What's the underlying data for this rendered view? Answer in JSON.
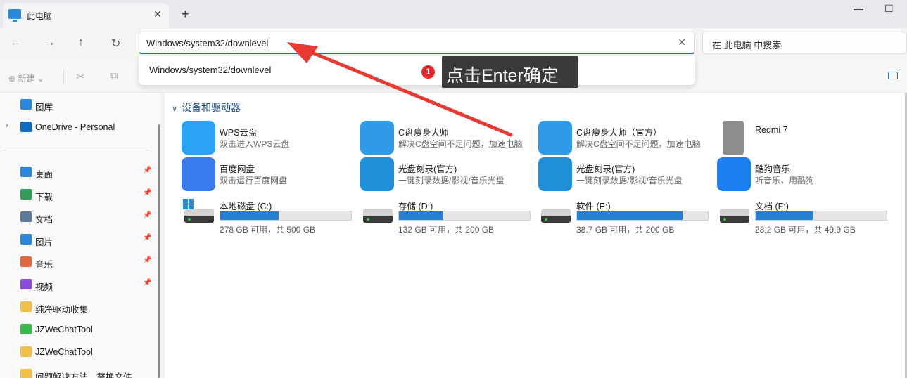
{
  "window": {
    "tab_title": "此电脑",
    "tab_close": "✕",
    "new_tab": "+",
    "min": "—",
    "max": "☐"
  },
  "nav": {
    "back": "←",
    "forward": "→",
    "up": "↑",
    "refresh": "↻"
  },
  "address": {
    "value": "Windows/system32/downlevel",
    "clear": "✕"
  },
  "search": {
    "placeholder": "在 此电脑 中搜索"
  },
  "toolbar": {
    "new_label": "新建 ⌄",
    "cut": "✂",
    "copy": "⧉"
  },
  "suggestion": {
    "text": "Windows/system32/downlevel"
  },
  "annotation": {
    "badge": "1",
    "text": "点击Enter确定",
    "arrow_color": "#e83a33"
  },
  "sidebar": {
    "items": [
      {
        "label": "图库",
        "icon": "gallery-icon",
        "color": "#2b88d8"
      },
      {
        "label": "OneDrive - Personal",
        "icon": "onedrive-icon",
        "color": "#0f6cbd",
        "expand": "›"
      },
      {
        "label": "桌面",
        "icon": "desktop-icon",
        "color": "#2b88d8",
        "pin": "📌"
      },
      {
        "label": "下载",
        "icon": "download-icon",
        "color": "#2e9e58",
        "pin": "📌"
      },
      {
        "label": "文档",
        "icon": "document-icon",
        "color": "#5c7a99",
        "pin": "📌"
      },
      {
        "label": "图片",
        "icon": "picture-icon",
        "color": "#2b88d8",
        "pin": "📌"
      },
      {
        "label": "音乐",
        "icon": "music-icon",
        "color": "#e0673e",
        "pin": "📌"
      },
      {
        "label": "视频",
        "icon": "video-icon",
        "color": "#8a4bd6",
        "pin": "📌"
      },
      {
        "label": "纯净驱动收集",
        "icon": "folder-icon",
        "color": "#f2c04a"
      },
      {
        "label": "JZWeChatTool",
        "icon": "wechat-icon",
        "color": "#35b94a"
      },
      {
        "label": "JZWeChatTool",
        "icon": "folder-icon",
        "color": "#f2c04a"
      },
      {
        "label": "问题解决方法、替换文件",
        "icon": "folder-icon",
        "color": "#f2c04a"
      }
    ]
  },
  "section": {
    "chevron": "∨",
    "title": "设备和驱动器"
  },
  "devices": [
    {
      "name": "WPS云盘",
      "sub": "双击进入WPS云盘",
      "icon": "wps-cloud-icon",
      "color": "#2ba3f5"
    },
    {
      "name": "C盘瘦身大师",
      "sub": "解决C盘空间不足问题，加速电脑",
      "icon": "c-cleaner-icon",
      "color": "#2f9be8"
    },
    {
      "name": "C盘瘦身大师（官方）",
      "sub": "解决C盘空间不足问题，加速电脑",
      "icon": "c-cleaner-icon",
      "color": "#2f9be8"
    },
    {
      "name": "Redmi 7",
      "sub": "",
      "icon": "phone-icon",
      "color": "#8d8d8d"
    },
    {
      "name": "百度网盘",
      "sub": "双击运行百度网盘",
      "icon": "baidu-netdisk-icon",
      "color": "#3a7bf0"
    },
    {
      "name": "光盘刻录(官方)",
      "sub": "一键刻录数据/影视/音乐光盘",
      "icon": "disc-burn-icon",
      "color": "#1f8fd8"
    },
    {
      "name": "光盘刻录(官方)",
      "sub": "一键刻录数据/影视/音乐光盘",
      "icon": "disc-burn-icon",
      "color": "#1f8fd8"
    },
    {
      "name": "酷狗音乐",
      "sub": "听音乐，用酷狗",
      "icon": "kugou-icon",
      "color": "#1a7ff0"
    }
  ],
  "drives": [
    {
      "name": "本地磁盘 (C:)",
      "free": "278 GB 可用，共 500 GB",
      "used_fraction": 0.444,
      "system": true
    },
    {
      "name": "存储 (D:)",
      "free": "132 GB 可用，共 200 GB",
      "used_fraction": 0.34
    },
    {
      "name": "软件 (E:)",
      "free": "38.7 GB 可用，共 200 GB",
      "used_fraction": 0.8065
    },
    {
      "name": "文档 (F:)",
      "free": "28.2 GB 可用，共 49.9 GB",
      "used_fraction": 0.435
    }
  ]
}
